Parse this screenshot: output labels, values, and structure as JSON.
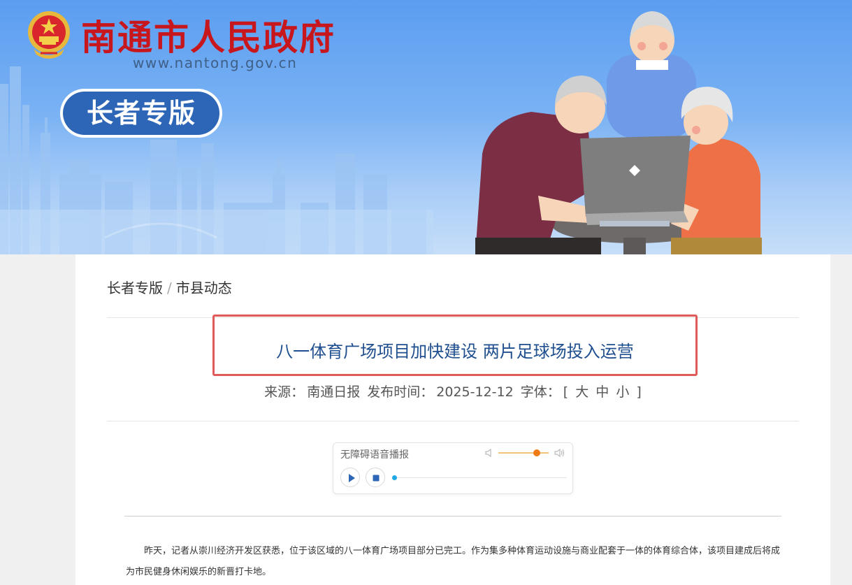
{
  "site": {
    "title": "南通市人民政府",
    "url": "www.nantong.gov.cn",
    "elder_badge": "长者专版"
  },
  "breadcrumb": {
    "items": [
      "长者专版",
      "市县动态"
    ],
    "separator": "/"
  },
  "article": {
    "title": "八一体育广场项目加快建设 两片足球场投入运营",
    "source_label": "来源：",
    "source": "南通日报",
    "publish_label": "发布时间：",
    "publish_date": "2025-12-12",
    "font_label": "字体：",
    "bracket_open": "[",
    "font_large": "大",
    "font_medium": "中",
    "font_small": "小",
    "bracket_close": "]",
    "body": "昨天，记者从崇川经济开发区获悉，位于该区域的八一体育广场项目部分已完工。作为集多种体育运动设施与商业配套于一体的体育综合体，该项目建成后将成为市民健身休闲娱乐的新晋打卡地。"
  },
  "player": {
    "title": "无障碍语音播报",
    "volume": 0.77,
    "progress": 0.0
  },
  "colors": {
    "brand_red": "#c8161d",
    "title_blue": "#1f4f8f",
    "highlight_border": "#e05a5a",
    "badge_blue": "#2d66b6",
    "volume_orange": "#f07a14",
    "progress_blue": "#23a8e6"
  }
}
